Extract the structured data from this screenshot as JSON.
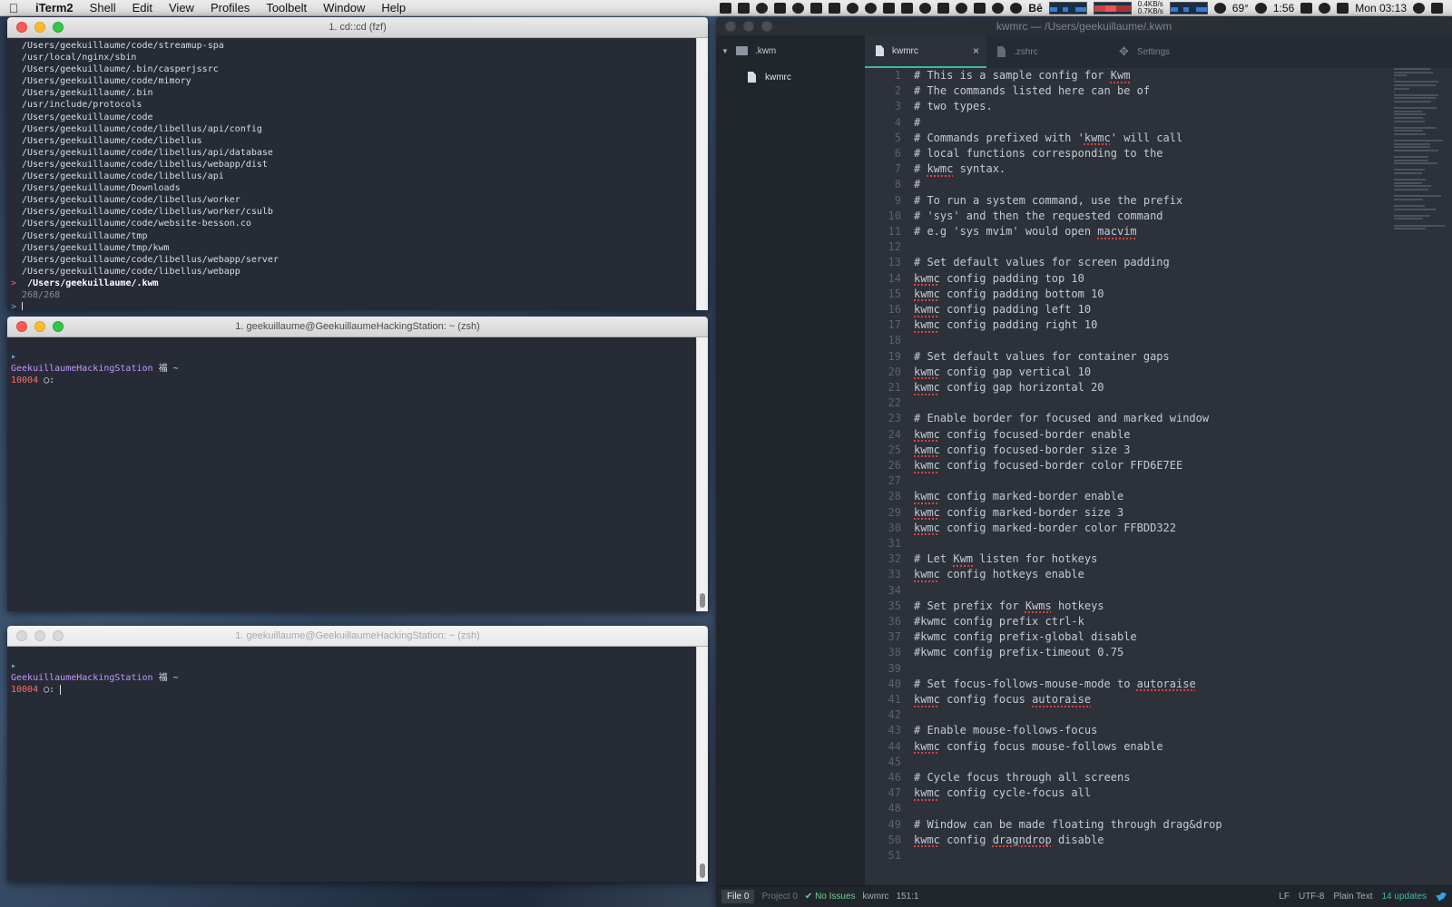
{
  "menubar": {
    "apple": "",
    "app_name": "iTerm2",
    "menus": [
      "Shell",
      "Edit",
      "View",
      "Profiles",
      "Toolbelt",
      "Window",
      "Help"
    ],
    "net_up": "0.4KB/s",
    "net_down": "0.7KB/s",
    "temperature": "69°",
    "clock_day": "Mon 03:13",
    "clock_time": "1:56"
  },
  "term1": {
    "title": "1. cd::cd (fzf)",
    "lines": [
      "/Users/geekuillaume/code/streamup-spa",
      "/usr/local/nginx/sbin",
      "/Users/geekuillaume/.bin/casperjssrc",
      "/Users/geekuillaume/code/mimory",
      "/Users/geekuillaume/.bin",
      "/usr/include/protocols",
      "/Users/geekuillaume/code",
      "/Users/geekuillaume/code/libellus/api/config",
      "/Users/geekuillaume/code/libellus",
      "/Users/geekuillaume/code/libellus/api/database",
      "/Users/geekuillaume/code/libellus/webapp/dist",
      "/Users/geekuillaume/code/libellus/api",
      "/Users/geekuillaume/Downloads",
      "/Users/geekuillaume/code/libellus/worker",
      "/Users/geekuillaume/code/libellus/worker/csulb",
      "/Users/geekuillaume/code/website-besson.co",
      "/Users/geekuillaume/tmp",
      "/Users/geekuillaume/tmp/kwm",
      "/Users/geekuillaume/code/libellus/webapp/server",
      "/Users/geekuillaume/code/libellus/webapp"
    ],
    "selected": "/Users/geekuillaume/.kwm",
    "pointer": ">",
    "count": "268/268",
    "prompt": ">"
  },
  "term2": {
    "title": "1. geekuillaume@GeekuillaumeHackingStation: ~ (zsh)",
    "host": "GeekuillaumeHackingStation",
    "glyph": "福 ~",
    "num": "10004",
    "circle": "◯",
    "colon": ":"
  },
  "term3": {
    "title": "1. geekuillaume@GeekuillaumeHackingStation: ~ (zsh)",
    "host": "GeekuillaumeHackingStation",
    "glyph": "福 ~",
    "num": "10004",
    "circle": "◯",
    "colon": ":"
  },
  "atom": {
    "title": "kwmrc — /Users/geekuillaume/.kwm",
    "tree_root": ".kwm",
    "tree_file": "kwmrc",
    "tabs": [
      {
        "label": "kwmrc",
        "active": true
      },
      {
        "label": ".zshrc",
        "active": false
      },
      {
        "label": "Settings",
        "active": false
      }
    ],
    "close_glyph": "×",
    "code": [
      [
        {
          "t": "# This is a sample config for "
        },
        {
          "t": "Kwm",
          "s": 1
        }
      ],
      [
        {
          "t": "# The commands listed here can be of"
        }
      ],
      [
        {
          "t": "# two types."
        }
      ],
      [
        {
          "t": "#"
        }
      ],
      [
        {
          "t": "# Commands prefixed with '"
        },
        {
          "t": "kwmc",
          "s": 1
        },
        {
          "t": "' will call"
        }
      ],
      [
        {
          "t": "# local functions corresponding to the"
        }
      ],
      [
        {
          "t": "# "
        },
        {
          "t": "kwmc",
          "s": 1
        },
        {
          "t": " syntax."
        }
      ],
      [
        {
          "t": "#"
        }
      ],
      [
        {
          "t": "# To run a system command, use the prefix"
        }
      ],
      [
        {
          "t": "# 'sys' and then the requested command"
        }
      ],
      [
        {
          "t": "# e.g 'sys mvim' would open "
        },
        {
          "t": "macvim",
          "s": 1
        }
      ],
      [],
      [
        {
          "t": "# Set default values for screen padding"
        }
      ],
      [
        {
          "t": "kwmc",
          "s": 1
        },
        {
          "t": " config padding top 10"
        }
      ],
      [
        {
          "t": "kwmc",
          "s": 1
        },
        {
          "t": " config padding bottom 10"
        }
      ],
      [
        {
          "t": "kwmc",
          "s": 1
        },
        {
          "t": " config padding left 10"
        }
      ],
      [
        {
          "t": "kwmc",
          "s": 1
        },
        {
          "t": " config padding right 10"
        }
      ],
      [],
      [
        {
          "t": "# Set default values for container gaps"
        }
      ],
      [
        {
          "t": "kwmc",
          "s": 1
        },
        {
          "t": " config gap vertical 10"
        }
      ],
      [
        {
          "t": "kwmc",
          "s": 1
        },
        {
          "t": " config gap horizontal 20"
        }
      ],
      [],
      [
        {
          "t": "# Enable border for focused and marked window"
        }
      ],
      [
        {
          "t": "kwmc",
          "s": 1
        },
        {
          "t": " config focused-border enable"
        }
      ],
      [
        {
          "t": "kwmc",
          "s": 1
        },
        {
          "t": " config focused-border size 3"
        }
      ],
      [
        {
          "t": "kwmc",
          "s": 1
        },
        {
          "t": " config focused-border color FFD6E7EE"
        }
      ],
      [],
      [
        {
          "t": "kwmc",
          "s": 1
        },
        {
          "t": " config marked-border enable"
        }
      ],
      [
        {
          "t": "kwmc",
          "s": 1
        },
        {
          "t": " config marked-border size 3"
        }
      ],
      [
        {
          "t": "kwmc",
          "s": 1
        },
        {
          "t": " config marked-border color FFBDD322"
        }
      ],
      [],
      [
        {
          "t": "# Let "
        },
        {
          "t": "Kwm",
          "s": 1
        },
        {
          "t": " listen for hotkeys"
        }
      ],
      [
        {
          "t": "kwmc",
          "s": 1
        },
        {
          "t": " config hotkeys enable"
        }
      ],
      [],
      [
        {
          "t": "# Set prefix for "
        },
        {
          "t": "Kwms",
          "s": 1
        },
        {
          "t": " hotkeys"
        }
      ],
      [
        {
          "t": "#kwmc config prefix ctrl-k"
        }
      ],
      [
        {
          "t": "#kwmc config prefix-global disable"
        }
      ],
      [
        {
          "t": "#kwmc config prefix-timeout 0.75"
        }
      ],
      [],
      [
        {
          "t": "# Set focus-follows-mouse-mode to "
        },
        {
          "t": "autoraise",
          "s": 1
        }
      ],
      [
        {
          "t": "kwmc",
          "s": 1
        },
        {
          "t": " config focus "
        },
        {
          "t": "autoraise",
          "s": 1
        }
      ],
      [],
      [
        {
          "t": "# Enable mouse-follows-focus"
        }
      ],
      [
        {
          "t": "kwmc",
          "s": 1
        },
        {
          "t": " config focus mouse-follows enable"
        }
      ],
      [],
      [
        {
          "t": "# Cycle focus through all screens"
        }
      ],
      [
        {
          "t": "kwmc",
          "s": 1
        },
        {
          "t": " config cycle-focus all"
        }
      ],
      [],
      [
        {
          "t": "# Window can be made floating through drag&drop"
        }
      ],
      [
        {
          "t": "kwmc",
          "s": 1
        },
        {
          "t": " config "
        },
        {
          "t": "dragndrop",
          "s": 1
        },
        {
          "t": " disable"
        }
      ],
      []
    ],
    "status": {
      "file": "File 0",
      "project": "Project 0",
      "issues": "✔ No Issues",
      "filename": "kwmrc",
      "cursor": "151:1",
      "line_ending": "LF",
      "encoding": "UTF-8",
      "grammar": "Plain Text",
      "updates": "14 updates"
    }
  }
}
